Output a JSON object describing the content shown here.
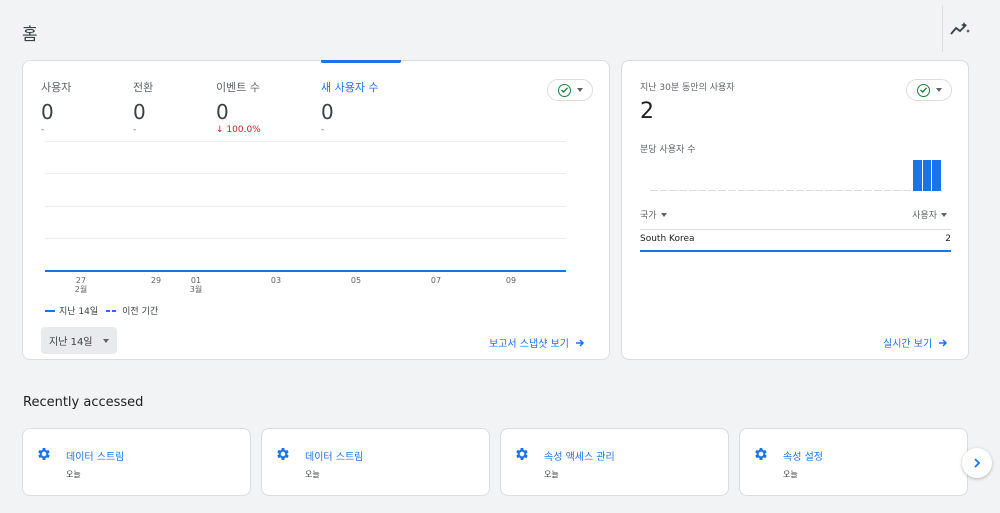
{
  "header": {
    "title": "홈",
    "insights_icon": "trend-sparkle-icon"
  },
  "overview": {
    "metrics": [
      {
        "label": "사용자",
        "value": "0",
        "change": "-"
      },
      {
        "label": "전환",
        "value": "0",
        "change": "-"
      },
      {
        "label": "이벤트 수",
        "value": "0",
        "change": "↓ 100.0%",
        "direction": "down"
      },
      {
        "label": "새 사용자 수",
        "value": "0",
        "change": "-",
        "active": true
      }
    ],
    "x_ticks": [
      {
        "day": "27",
        "month": "2월"
      },
      {
        "day": "29",
        "month": ""
      },
      {
        "day": "01",
        "month": "3월"
      },
      {
        "day": "03",
        "month": ""
      },
      {
        "day": "05",
        "month": ""
      },
      {
        "day": "07",
        "month": ""
      },
      {
        "day": "09",
        "month": ""
      }
    ],
    "legend": {
      "current": "지난 14일",
      "previous": "이전 기간"
    },
    "date_range": "지난 14일",
    "snapshot_link": "보고서 스냅샷 보기",
    "colors": {
      "accent": "#1a73e8",
      "negative": "#c5221f",
      "ok": "#188038"
    }
  },
  "chart_data": {
    "type": "line",
    "x": [
      "27",
      "29",
      "01",
      "03",
      "05",
      "07",
      "09"
    ],
    "series": [
      {
        "name": "지난 14일",
        "values": [
          0,
          0,
          0,
          0,
          0,
          0,
          0
        ]
      }
    ],
    "xlabel": "",
    "ylabel": ""
  },
  "realtime": {
    "label": "지난 30분 동안의 사용자",
    "value": "2",
    "sub_label": "분당 사용자 수",
    "bars_per_minute": [
      0,
      0,
      0,
      0,
      0,
      0,
      0,
      0,
      0,
      0,
      0,
      0,
      0,
      0,
      0,
      0,
      0,
      0,
      0,
      0,
      0,
      0,
      0,
      0,
      0,
      0,
      0,
      1,
      1,
      1
    ],
    "table": {
      "col_country": "국가",
      "col_users": "사용자",
      "rows": [
        {
          "country": "South Korea",
          "users": "2"
        }
      ]
    },
    "link": "실시간 보기"
  },
  "recent": {
    "title": "Recently accessed",
    "items": [
      {
        "title": "데이터 스트림",
        "time": "오늘"
      },
      {
        "title": "데이터 스트림",
        "time": "오늘"
      },
      {
        "title": "속성 액세스 관리",
        "time": "오늘"
      },
      {
        "title": "속성 설정",
        "time": "오늘"
      }
    ]
  }
}
